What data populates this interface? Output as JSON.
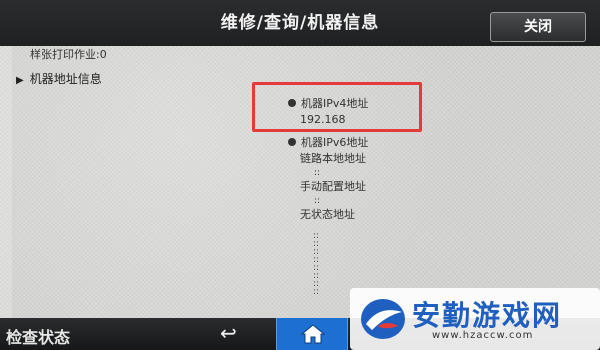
{
  "header": {
    "title": "维修/查询/机器信息",
    "close_label": "关闭"
  },
  "content": {
    "sample_line": "样张打印作业:0",
    "section_label": "机器地址信息",
    "ipv4_label": "机器IPv4地址",
    "ipv4_value": "192.168",
    "ipv6_label": "机器IPv6地址",
    "link_local_label": "链路本地地址",
    "manual_label": "手动配置地址",
    "stateless_label": "无状态地址",
    "separator": "::"
  },
  "footer": {
    "status_label": "检查状态",
    "back_symbol": "↩"
  },
  "watermark": {
    "title": "安勤游戏网",
    "url": "www.hzaccw.com"
  },
  "colors": {
    "header_bg": "#1e2022",
    "highlight": "#e43a3a",
    "home_button": "#1d6fd1",
    "brand_blue": "#1f5fbf"
  }
}
